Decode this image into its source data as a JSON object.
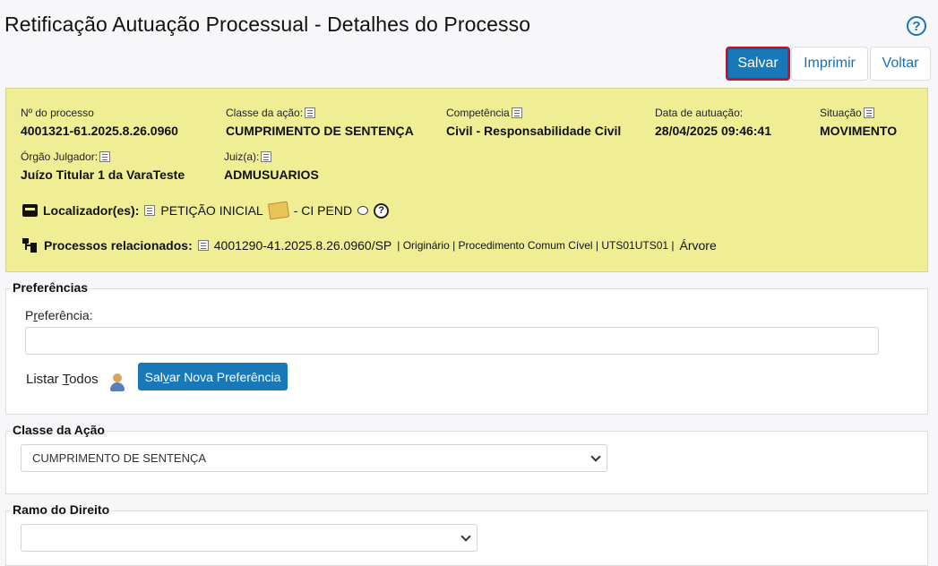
{
  "header": {
    "title": "Retificação Autuação Processual - Detalhes do Processo",
    "help_icon": "question-circle-icon"
  },
  "toolbar": {
    "salvar": "Salvar",
    "imprimir": "Imprimir",
    "voltar": "Voltar"
  },
  "processo": {
    "numero_label": "Nº do processo",
    "numero": "4001321-61.2025.8.26.0960",
    "classe_label": "Classe da ação:",
    "classe": "CUMPRIMENTO DE SENTENÇA",
    "competencia_label": "Competência",
    "competencia": "Civil - Responsabilidade Civil",
    "data_label": "Data de autuação:",
    "data": "28/04/2025 09:46:41",
    "situacao_label": "Situação",
    "situacao": "MOVIMENTO",
    "orgao_label": "Órgão Julgador:",
    "orgao": "Juízo Titular 1 da VaraTeste",
    "juiz_label": "Juiz(a):",
    "juiz": "ADMUSUARIOS",
    "localizador_label": "Localizador(es):",
    "localizador_1": "PETIÇÃO INICIAL",
    "localizador_2": "- CI PEND",
    "relacionados_label": "Processos relacionados:",
    "relacionado_numero": "4001290-41.2025.8.26.0960/SP",
    "relacionado_detalhe": "| Originário | Procedimento Comum Cível | UTS01UTS01 |",
    "relacionado_arvore": "Árvore"
  },
  "preferencias": {
    "legend": "Preferências",
    "label_pre": "P",
    "label_u": "r",
    "label_post": "eferência:",
    "input_value": "",
    "listar_pre": "Listar ",
    "listar_u": "T",
    "listar_post": "odos",
    "nova_pre": "Sal",
    "nova_u": "v",
    "nova_post": "ar Nova Preferência"
  },
  "classe_acao": {
    "legend": "Classe da Ação",
    "selected": "CUMPRIMENTO DE SENTENÇA"
  },
  "ramo_direito": {
    "legend": "Ramo do Direito",
    "selected": ""
  }
}
